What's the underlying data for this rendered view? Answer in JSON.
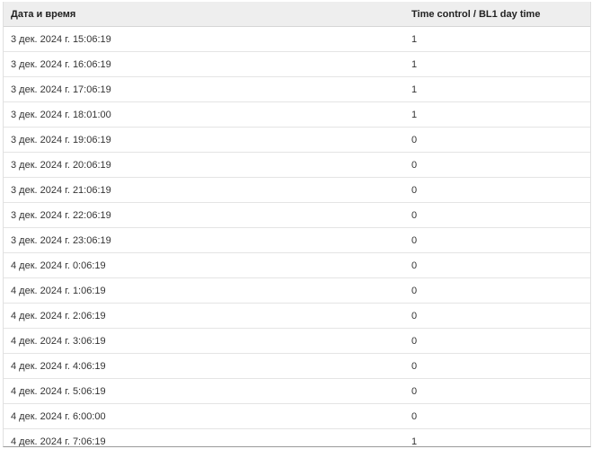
{
  "table": {
    "headers": [
      "Дата и время",
      "Time control / BL1 day time"
    ],
    "rows": [
      [
        "3 дек. 2024 г. 15:06:19",
        "1"
      ],
      [
        "3 дек. 2024 г. 16:06:19",
        "1"
      ],
      [
        "3 дек. 2024 г. 17:06:19",
        "1"
      ],
      [
        "3 дек. 2024 г. 18:01:00",
        "1"
      ],
      [
        "3 дек. 2024 г. 19:06:19",
        "0"
      ],
      [
        "3 дек. 2024 г. 20:06:19",
        "0"
      ],
      [
        "3 дек. 2024 г. 21:06:19",
        "0"
      ],
      [
        "3 дек. 2024 г. 22:06:19",
        "0"
      ],
      [
        "3 дек. 2024 г. 23:06:19",
        "0"
      ],
      [
        "4 дек. 2024 г. 0:06:19",
        "0"
      ],
      [
        "4 дек. 2024 г. 1:06:19",
        "0"
      ],
      [
        "4 дек. 2024 г. 2:06:19",
        "0"
      ],
      [
        "4 дек. 2024 г. 3:06:19",
        "0"
      ],
      [
        "4 дек. 2024 г. 4:06:19",
        "0"
      ],
      [
        "4 дек. 2024 г. 5:06:19",
        "0"
      ],
      [
        "4 дек. 2024 г. 6:00:00",
        "0"
      ],
      [
        "4 дек. 2024 г. 7:06:19",
        "1"
      ]
    ]
  }
}
